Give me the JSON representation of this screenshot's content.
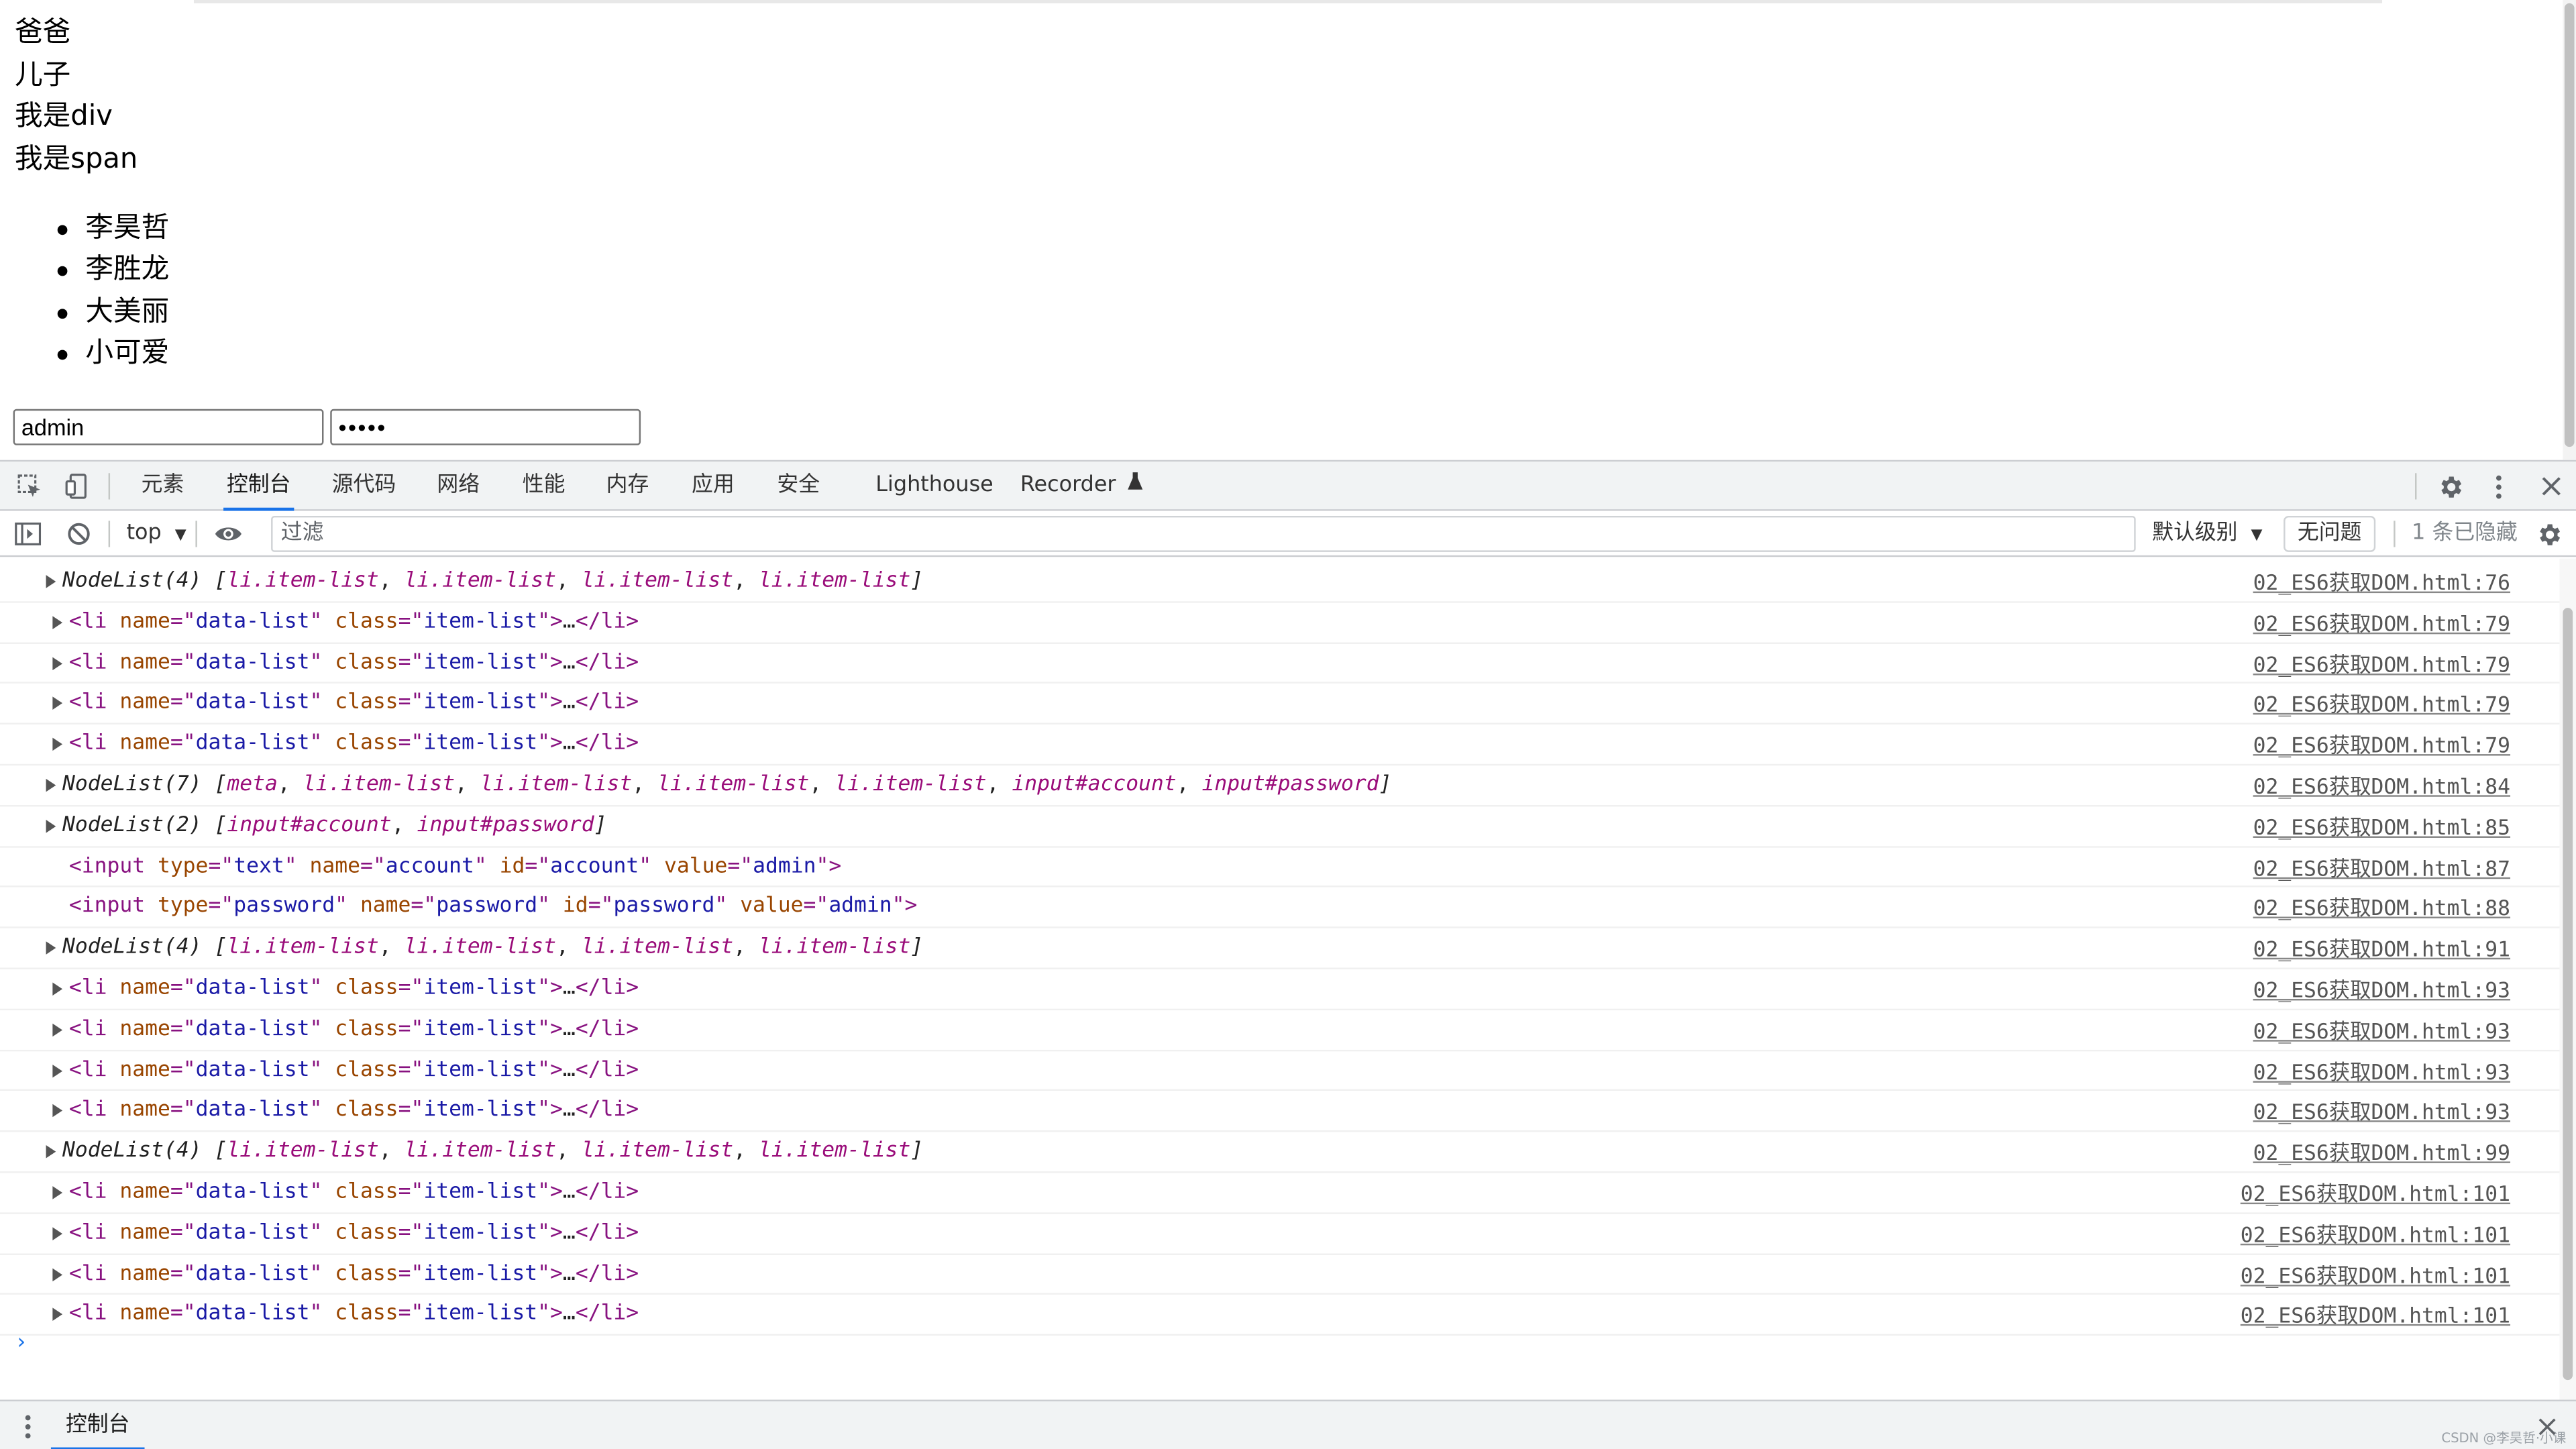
{
  "page": {
    "lines": [
      "爸爸",
      "儿子",
      "我是div",
      "我是span"
    ],
    "list_items": [
      "李昊哲",
      "李胜龙",
      "大美丽",
      "小可爱"
    ],
    "account_value": "admin",
    "password_mask": "•••••"
  },
  "devtools": {
    "tabs": [
      "元素",
      "控制台",
      "源代码",
      "网络",
      "性能",
      "内存",
      "应用",
      "安全",
      "Lighthouse",
      "Recorder"
    ],
    "active_tab": "控制台",
    "toolbar": {
      "context": "top",
      "filter_placeholder": "过滤",
      "level": "默认级别",
      "issues": "无问题",
      "hidden": "1 条已隐藏"
    },
    "console_rows": [
      {
        "arrow": true,
        "src": "02_ES6获取DOM.html:76",
        "segs": [
          [
            "NodeList(4) ",
            "c-plain c-it"
          ],
          [
            "[",
            "c-plain c-it"
          ],
          [
            "li.item-list",
            "c-node"
          ],
          [
            ", ",
            "c-plain"
          ],
          [
            "li.item-list",
            "c-node"
          ],
          [
            ", ",
            "c-plain"
          ],
          [
            "li.item-list",
            "c-node"
          ],
          [
            ", ",
            "c-plain"
          ],
          [
            "li.item-list",
            "c-node"
          ],
          [
            "]",
            "c-plain c-it"
          ]
        ]
      },
      {
        "arrow": true,
        "src": "02_ES6获取DOM.html:79",
        "segs": [
          [
            "<li ",
            "c-tag"
          ],
          [
            "name",
            "c-attr"
          ],
          [
            "=\"",
            "c-tag"
          ],
          [
            "data-list",
            "c-val"
          ],
          [
            "\" ",
            "c-tag"
          ],
          [
            "class",
            "c-attr"
          ],
          [
            "=\"",
            "c-tag"
          ],
          [
            "item-list",
            "c-val"
          ],
          [
            "\">",
            "c-tag"
          ],
          [
            "…",
            "c-plain"
          ],
          [
            "</li>",
            "c-tag"
          ]
        ]
      },
      {
        "arrow": true,
        "src": "02_ES6获取DOM.html:79",
        "segs": [
          [
            "<li ",
            "c-tag"
          ],
          [
            "name",
            "c-attr"
          ],
          [
            "=\"",
            "c-tag"
          ],
          [
            "data-list",
            "c-val"
          ],
          [
            "\" ",
            "c-tag"
          ],
          [
            "class",
            "c-attr"
          ],
          [
            "=\"",
            "c-tag"
          ],
          [
            "item-list",
            "c-val"
          ],
          [
            "\">",
            "c-tag"
          ],
          [
            "…",
            "c-plain"
          ],
          [
            "</li>",
            "c-tag"
          ]
        ]
      },
      {
        "arrow": true,
        "src": "02_ES6获取DOM.html:79",
        "segs": [
          [
            "<li ",
            "c-tag"
          ],
          [
            "name",
            "c-attr"
          ],
          [
            "=\"",
            "c-tag"
          ],
          [
            "data-list",
            "c-val"
          ],
          [
            "\" ",
            "c-tag"
          ],
          [
            "class",
            "c-attr"
          ],
          [
            "=\"",
            "c-tag"
          ],
          [
            "item-list",
            "c-val"
          ],
          [
            "\">",
            "c-tag"
          ],
          [
            "…",
            "c-plain"
          ],
          [
            "</li>",
            "c-tag"
          ]
        ]
      },
      {
        "arrow": true,
        "src": "02_ES6获取DOM.html:79",
        "segs": [
          [
            "<li ",
            "c-tag"
          ],
          [
            "name",
            "c-attr"
          ],
          [
            "=\"",
            "c-tag"
          ],
          [
            "data-list",
            "c-val"
          ],
          [
            "\" ",
            "c-tag"
          ],
          [
            "class",
            "c-attr"
          ],
          [
            "=\"",
            "c-tag"
          ],
          [
            "item-list",
            "c-val"
          ],
          [
            "\">",
            "c-tag"
          ],
          [
            "…",
            "c-plain"
          ],
          [
            "</li>",
            "c-tag"
          ]
        ]
      },
      {
        "arrow": true,
        "src": "02_ES6获取DOM.html:84",
        "segs": [
          [
            "NodeList(7) ",
            "c-plain c-it"
          ],
          [
            "[",
            "c-plain c-it"
          ],
          [
            "meta",
            "c-node"
          ],
          [
            ", ",
            "c-plain"
          ],
          [
            "li.item-list",
            "c-node"
          ],
          [
            ", ",
            "c-plain"
          ],
          [
            "li.item-list",
            "c-node"
          ],
          [
            ", ",
            "c-plain"
          ],
          [
            "li.item-list",
            "c-node"
          ],
          [
            ", ",
            "c-plain"
          ],
          [
            "li.item-list",
            "c-node"
          ],
          [
            ", ",
            "c-plain"
          ],
          [
            "input#account",
            "c-node"
          ],
          [
            ", ",
            "c-plain"
          ],
          [
            "input#password",
            "c-node"
          ],
          [
            "]",
            "c-plain c-it"
          ]
        ]
      },
      {
        "arrow": true,
        "src": "02_ES6获取DOM.html:85",
        "segs": [
          [
            "NodeList(2) ",
            "c-plain c-it"
          ],
          [
            "[",
            "c-plain c-it"
          ],
          [
            "input#account",
            "c-node"
          ],
          [
            ", ",
            "c-plain"
          ],
          [
            "input#password",
            "c-node"
          ],
          [
            "]",
            "c-plain c-it"
          ]
        ]
      },
      {
        "arrow": false,
        "src": "02_ES6获取DOM.html:87",
        "segs": [
          [
            "<input ",
            "c-tag"
          ],
          [
            "type",
            "c-attr"
          ],
          [
            "=\"",
            "c-tag"
          ],
          [
            "text",
            "c-val"
          ],
          [
            "\" ",
            "c-tag"
          ],
          [
            "name",
            "c-attr"
          ],
          [
            "=\"",
            "c-tag"
          ],
          [
            "account",
            "c-val"
          ],
          [
            "\" ",
            "c-tag"
          ],
          [
            "id",
            "c-attr"
          ],
          [
            "=\"",
            "c-tag"
          ],
          [
            "account",
            "c-val"
          ],
          [
            "\" ",
            "c-tag"
          ],
          [
            "value",
            "c-attr"
          ],
          [
            "=\"",
            "c-tag"
          ],
          [
            "admin",
            "c-val"
          ],
          [
            "\">",
            "c-tag"
          ]
        ]
      },
      {
        "arrow": false,
        "src": "02_ES6获取DOM.html:88",
        "segs": [
          [
            "<input ",
            "c-tag"
          ],
          [
            "type",
            "c-attr"
          ],
          [
            "=\"",
            "c-tag"
          ],
          [
            "password",
            "c-val"
          ],
          [
            "\" ",
            "c-tag"
          ],
          [
            "name",
            "c-attr"
          ],
          [
            "=\"",
            "c-tag"
          ],
          [
            "password",
            "c-val"
          ],
          [
            "\" ",
            "c-tag"
          ],
          [
            "id",
            "c-attr"
          ],
          [
            "=\"",
            "c-tag"
          ],
          [
            "password",
            "c-val"
          ],
          [
            "\" ",
            "c-tag"
          ],
          [
            "value",
            "c-attr"
          ],
          [
            "=\"",
            "c-tag"
          ],
          [
            "admin",
            "c-val"
          ],
          [
            "\">",
            "c-tag"
          ]
        ]
      },
      {
        "arrow": true,
        "src": "02_ES6获取DOM.html:91",
        "segs": [
          [
            "NodeList(4) ",
            "c-plain c-it"
          ],
          [
            "[",
            "c-plain c-it"
          ],
          [
            "li.item-list",
            "c-node"
          ],
          [
            ", ",
            "c-plain"
          ],
          [
            "li.item-list",
            "c-node"
          ],
          [
            ", ",
            "c-plain"
          ],
          [
            "li.item-list",
            "c-node"
          ],
          [
            ", ",
            "c-plain"
          ],
          [
            "li.item-list",
            "c-node"
          ],
          [
            "]",
            "c-plain c-it"
          ]
        ]
      },
      {
        "arrow": true,
        "src": "02_ES6获取DOM.html:93",
        "segs": [
          [
            "<li ",
            "c-tag"
          ],
          [
            "name",
            "c-attr"
          ],
          [
            "=\"",
            "c-tag"
          ],
          [
            "data-list",
            "c-val"
          ],
          [
            "\" ",
            "c-tag"
          ],
          [
            "class",
            "c-attr"
          ],
          [
            "=\"",
            "c-tag"
          ],
          [
            "item-list",
            "c-val"
          ],
          [
            "\">",
            "c-tag"
          ],
          [
            "…",
            "c-plain"
          ],
          [
            "</li>",
            "c-tag"
          ]
        ]
      },
      {
        "arrow": true,
        "src": "02_ES6获取DOM.html:93",
        "segs": [
          [
            "<li ",
            "c-tag"
          ],
          [
            "name",
            "c-attr"
          ],
          [
            "=\"",
            "c-tag"
          ],
          [
            "data-list",
            "c-val"
          ],
          [
            "\" ",
            "c-tag"
          ],
          [
            "class",
            "c-attr"
          ],
          [
            "=\"",
            "c-tag"
          ],
          [
            "item-list",
            "c-val"
          ],
          [
            "\">",
            "c-tag"
          ],
          [
            "…",
            "c-plain"
          ],
          [
            "</li>",
            "c-tag"
          ]
        ]
      },
      {
        "arrow": true,
        "src": "02_ES6获取DOM.html:93",
        "segs": [
          [
            "<li ",
            "c-tag"
          ],
          [
            "name",
            "c-attr"
          ],
          [
            "=\"",
            "c-tag"
          ],
          [
            "data-list",
            "c-val"
          ],
          [
            "\" ",
            "c-tag"
          ],
          [
            "class",
            "c-attr"
          ],
          [
            "=\"",
            "c-tag"
          ],
          [
            "item-list",
            "c-val"
          ],
          [
            "\">",
            "c-tag"
          ],
          [
            "…",
            "c-plain"
          ],
          [
            "</li>",
            "c-tag"
          ]
        ]
      },
      {
        "arrow": true,
        "src": "02_ES6获取DOM.html:93",
        "segs": [
          [
            "<li ",
            "c-tag"
          ],
          [
            "name",
            "c-attr"
          ],
          [
            "=\"",
            "c-tag"
          ],
          [
            "data-list",
            "c-val"
          ],
          [
            "\" ",
            "c-tag"
          ],
          [
            "class",
            "c-attr"
          ],
          [
            "=\"",
            "c-tag"
          ],
          [
            "item-list",
            "c-val"
          ],
          [
            "\">",
            "c-tag"
          ],
          [
            "…",
            "c-plain"
          ],
          [
            "</li>",
            "c-tag"
          ]
        ]
      },
      {
        "arrow": true,
        "src": "02_ES6获取DOM.html:99",
        "segs": [
          [
            "NodeList(4) ",
            "c-plain c-it"
          ],
          [
            "[",
            "c-plain c-it"
          ],
          [
            "li.item-list",
            "c-node"
          ],
          [
            ", ",
            "c-plain"
          ],
          [
            "li.item-list",
            "c-node"
          ],
          [
            ", ",
            "c-plain"
          ],
          [
            "li.item-list",
            "c-node"
          ],
          [
            ", ",
            "c-plain"
          ],
          [
            "li.item-list",
            "c-node"
          ],
          [
            "]",
            "c-plain c-it"
          ]
        ]
      },
      {
        "arrow": true,
        "src": "02_ES6获取DOM.html:101",
        "segs": [
          [
            "<li ",
            "c-tag"
          ],
          [
            "name",
            "c-attr"
          ],
          [
            "=\"",
            "c-tag"
          ],
          [
            "data-list",
            "c-val"
          ],
          [
            "\" ",
            "c-tag"
          ],
          [
            "class",
            "c-attr"
          ],
          [
            "=\"",
            "c-tag"
          ],
          [
            "item-list",
            "c-val"
          ],
          [
            "\">",
            "c-tag"
          ],
          [
            "…",
            "c-plain"
          ],
          [
            "</li>",
            "c-tag"
          ]
        ]
      },
      {
        "arrow": true,
        "src": "02_ES6获取DOM.html:101",
        "segs": [
          [
            "<li ",
            "c-tag"
          ],
          [
            "name",
            "c-attr"
          ],
          [
            "=\"",
            "c-tag"
          ],
          [
            "data-list",
            "c-val"
          ],
          [
            "\" ",
            "c-tag"
          ],
          [
            "class",
            "c-attr"
          ],
          [
            "=\"",
            "c-tag"
          ],
          [
            "item-list",
            "c-val"
          ],
          [
            "\">",
            "c-tag"
          ],
          [
            "…",
            "c-plain"
          ],
          [
            "</li>",
            "c-tag"
          ]
        ]
      },
      {
        "arrow": true,
        "src": "02_ES6获取DOM.html:101",
        "segs": [
          [
            "<li ",
            "c-tag"
          ],
          [
            "name",
            "c-attr"
          ],
          [
            "=\"",
            "c-tag"
          ],
          [
            "data-list",
            "c-val"
          ],
          [
            "\" ",
            "c-tag"
          ],
          [
            "class",
            "c-attr"
          ],
          [
            "=\"",
            "c-tag"
          ],
          [
            "item-list",
            "c-val"
          ],
          [
            "\">",
            "c-tag"
          ],
          [
            "…",
            "c-plain"
          ],
          [
            "</li>",
            "c-tag"
          ]
        ]
      },
      {
        "arrow": true,
        "src": "02_ES6获取DOM.html:101",
        "segs": [
          [
            "<li ",
            "c-tag"
          ],
          [
            "name",
            "c-attr"
          ],
          [
            "=\"",
            "c-tag"
          ],
          [
            "data-list",
            "c-val"
          ],
          [
            "\" ",
            "c-tag"
          ],
          [
            "class",
            "c-attr"
          ],
          [
            "=\"",
            "c-tag"
          ],
          [
            "item-list",
            "c-val"
          ],
          [
            "\">",
            "c-tag"
          ],
          [
            "…",
            "c-plain"
          ],
          [
            "</li>",
            "c-tag"
          ]
        ]
      }
    ],
    "prompt": "›",
    "drawer_tab": "控制台",
    "watermark": "CSDN @李昊哲·小课"
  },
  "colors": {
    "accent": "#1a73e8",
    "tag": "#881280",
    "attr": "#994500",
    "value": "#1a1aa6",
    "node": "#9a0d7a"
  },
  "icons": [
    "inspect-element-icon",
    "device-toolbar-icon",
    "flask-icon",
    "gear-icon",
    "kebab-menu-icon",
    "close-icon",
    "sidebar-toggle-icon",
    "clear-console-icon",
    "dropdown-arrow-icon",
    "eye-icon"
  ]
}
